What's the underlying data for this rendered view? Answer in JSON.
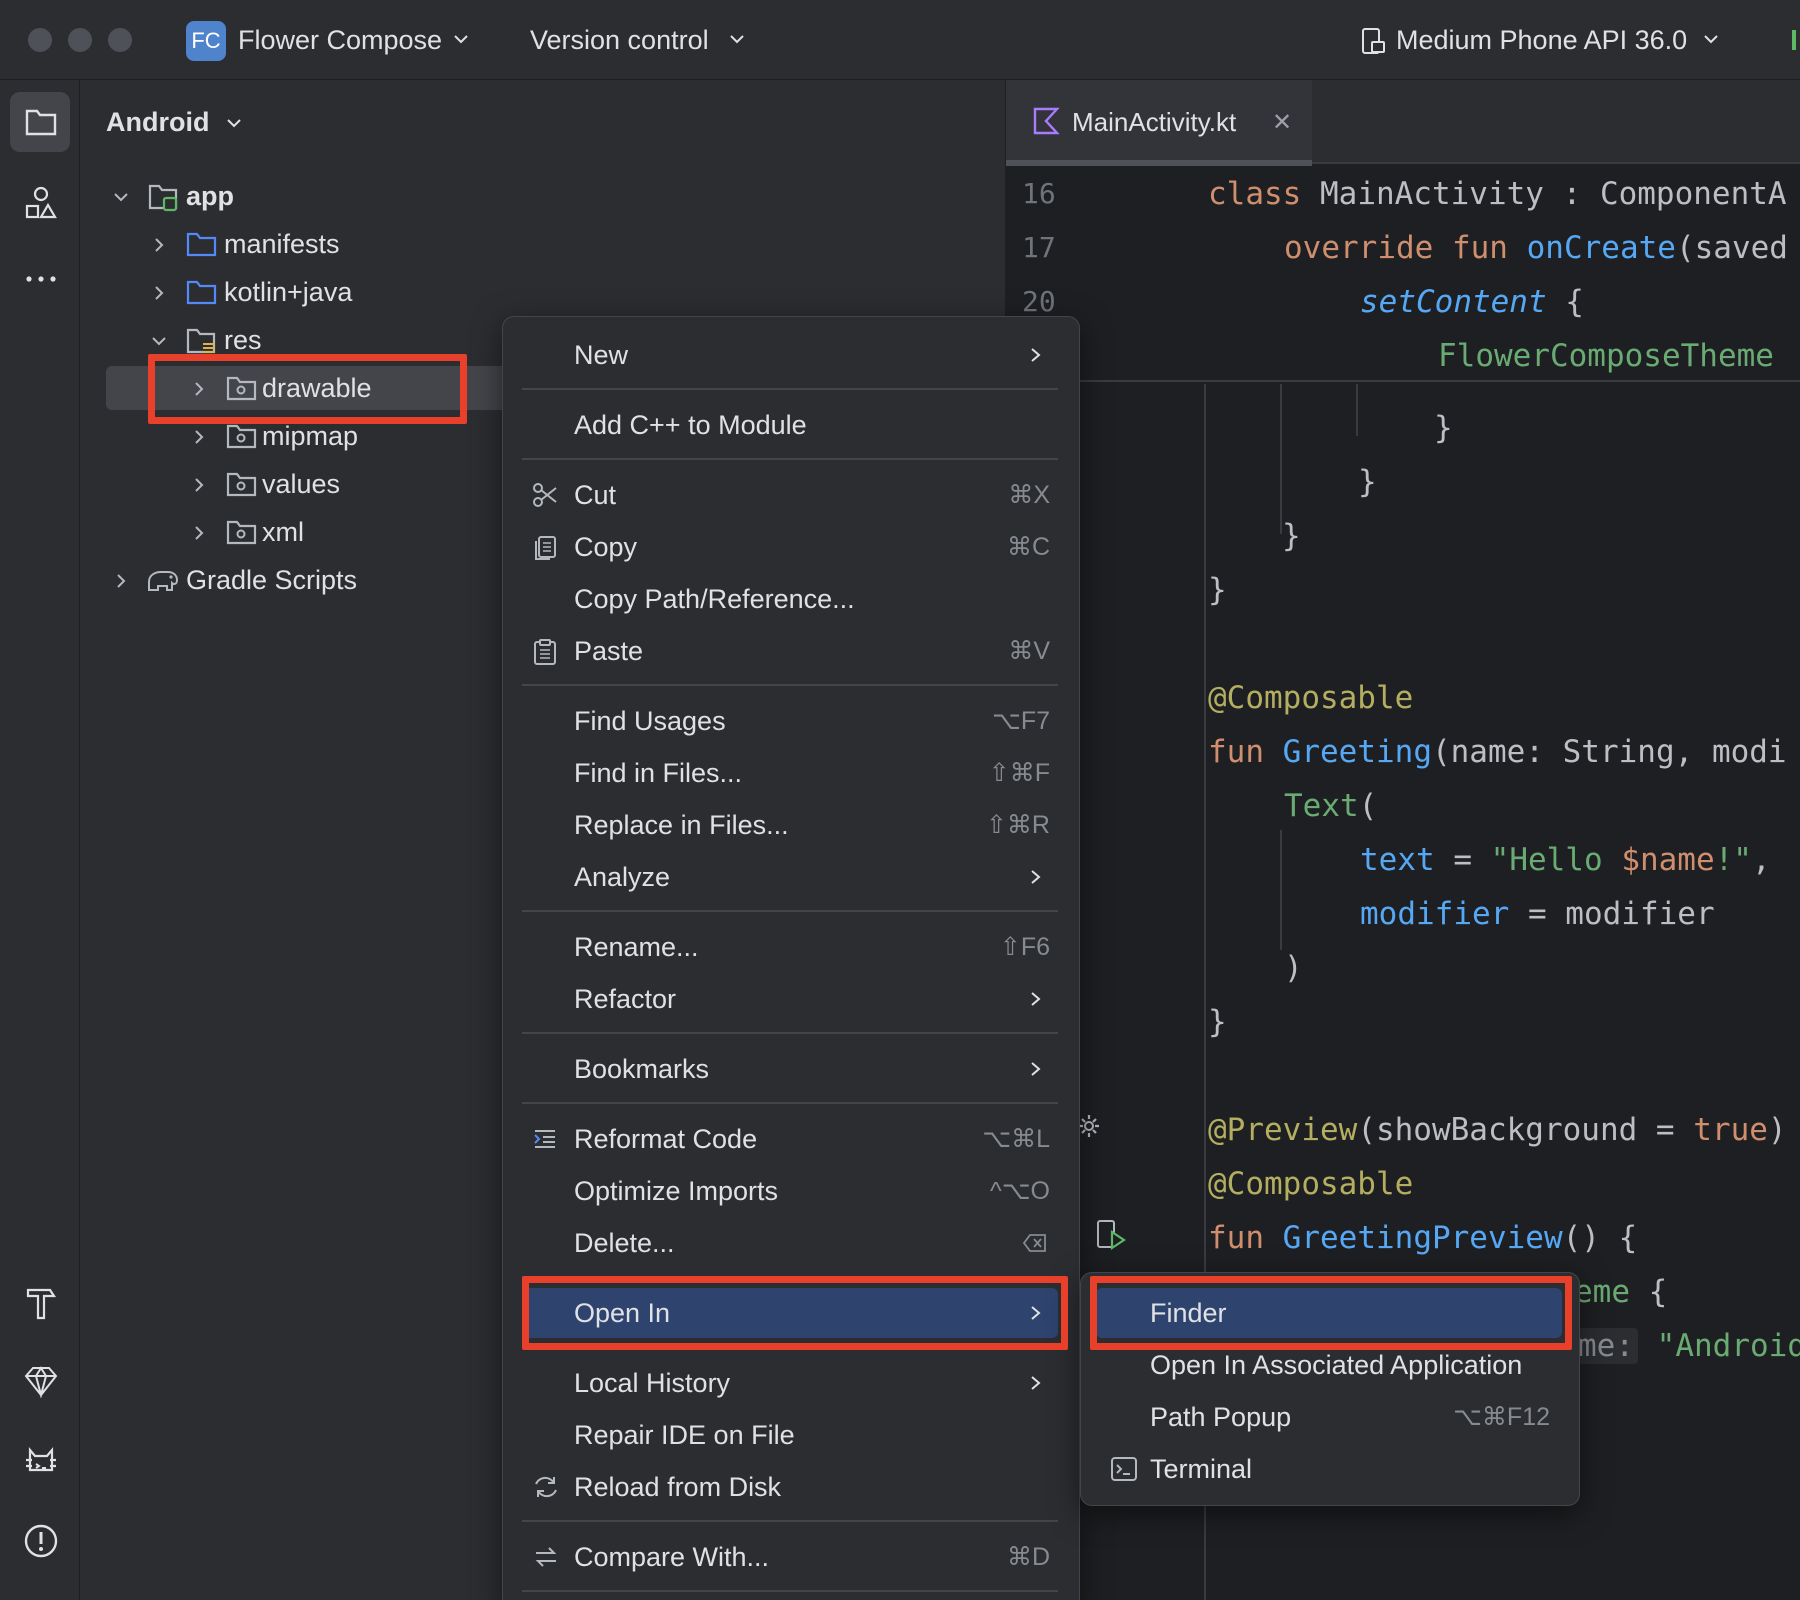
{
  "titlebar": {
    "project_badge": "FC",
    "project_name": "Flower Compose",
    "version_control": "Version control",
    "device": "Medium Phone API 36.0"
  },
  "project_panel": {
    "view_mode": "Android",
    "tree": {
      "app": "app",
      "manifests": "manifests",
      "kotlin_java": "kotlin+java",
      "res": "res",
      "drawable": "drawable",
      "mipmap": "mipmap",
      "values": "values",
      "xml": "xml",
      "gradle_scripts": "Gradle Scripts"
    }
  },
  "editor": {
    "tab_label": "MainActivity.kt",
    "line_numbers": [
      "16",
      "17",
      "20"
    ]
  },
  "context_menu": {
    "new": "New",
    "add_cpp": "Add C++ to Module",
    "cut": "Cut",
    "cut_sc": "⌘X",
    "copy": "Copy",
    "copy_sc": "⌘C",
    "copy_path": "Copy Path/Reference...",
    "paste": "Paste",
    "paste_sc": "⌘V",
    "find_usages": "Find Usages",
    "find_usages_sc": "⌥F7",
    "find_in_files": "Find in Files...",
    "find_in_files_sc": "⇧⌘F",
    "replace_in_files": "Replace in Files...",
    "replace_in_files_sc": "⇧⌘R",
    "analyze": "Analyze",
    "rename": "Rename...",
    "rename_sc": "⇧F6",
    "refactor": "Refactor",
    "bookmarks": "Bookmarks",
    "reformat": "Reformat Code",
    "reformat_sc": "⌥⌘L",
    "optimize": "Optimize Imports",
    "optimize_sc": "^⌥O",
    "delete": "Delete...",
    "open_in": "Open In",
    "local_history": "Local History",
    "repair": "Repair IDE on File",
    "reload": "Reload from Disk",
    "compare": "Compare With...",
    "compare_sc": "⌘D"
  },
  "submenu": {
    "finder": "Finder",
    "associated": "Open In Associated Application",
    "path_popup": "Path Popup",
    "path_popup_sc": "⌥⌘F12",
    "terminal": "Terminal"
  },
  "colors": {
    "highlight": "#2e436e",
    "annotation_red": "#e8402a",
    "folder_blue": "#548af7"
  }
}
